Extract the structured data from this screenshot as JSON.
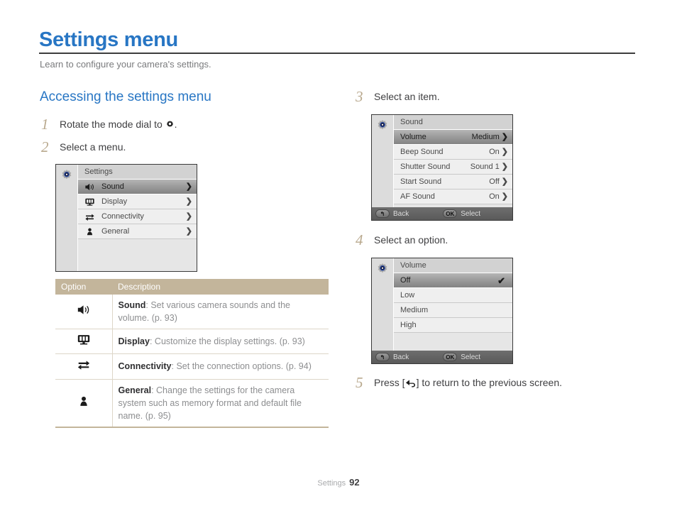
{
  "page": {
    "title": "Settings menu",
    "subtitle": "Learn to configure your camera's settings.",
    "section_heading": "Accessing the settings menu",
    "footer_label": "Settings",
    "footer_page": "92",
    "accent_color": "#2876c4",
    "step_number_color": "#b9a98e",
    "table_header_color": "#c3b59b"
  },
  "steps": {
    "one": {
      "num": "1",
      "text_before": "Rotate the mode dial to",
      "icon": "gear-icon",
      "text_after": "."
    },
    "two": {
      "num": "2",
      "text": "Select a menu."
    },
    "three": {
      "num": "3",
      "text": "Select an item."
    },
    "four": {
      "num": "4",
      "text": "Select an option."
    },
    "five": {
      "num": "5",
      "text_before": "Press [",
      "icon": "back-arrow-icon",
      "text_after": "] to return to the previous screen."
    }
  },
  "screen_settings": {
    "title": "Settings",
    "rows": [
      {
        "icon": "speaker-icon",
        "label": "Sound",
        "value": "",
        "chevron": "❯",
        "selected": true
      },
      {
        "icon": "display-icon",
        "label": "Display",
        "value": "",
        "chevron": "❯",
        "selected": false
      },
      {
        "icon": "connectivity-icon",
        "label": "Connectivity",
        "value": "",
        "chevron": "❯",
        "selected": false
      },
      {
        "icon": "person-icon",
        "label": "General",
        "value": "",
        "chevron": "❯",
        "selected": false
      }
    ]
  },
  "screen_sound": {
    "title": "Sound",
    "rows": [
      {
        "label": "Volume",
        "value": "Medium",
        "chevron": "❯",
        "selected": true
      },
      {
        "label": "Beep Sound",
        "value": "On",
        "chevron": "❯",
        "selected": false
      },
      {
        "label": "Shutter Sound",
        "value": "Sound 1",
        "chevron": "❯",
        "selected": false
      },
      {
        "label": "Start Sound",
        "value": "Off",
        "chevron": "❯",
        "selected": false
      },
      {
        "label": "AF Sound",
        "value": "On",
        "chevron": "❯",
        "selected": false
      }
    ],
    "bottom": {
      "back_key": "↰",
      "back_label": "Back",
      "ok_key": "OK",
      "ok_label": "Select"
    }
  },
  "screen_volume": {
    "title": "Volume",
    "rows": [
      {
        "label": "Off",
        "checked": true,
        "selected": true
      },
      {
        "label": "Low",
        "checked": false,
        "selected": false
      },
      {
        "label": "Medium",
        "checked": false,
        "selected": false
      },
      {
        "label": "High",
        "checked": false,
        "selected": false
      }
    ],
    "check_glyph": "✔",
    "bottom": {
      "back_key": "↰",
      "back_label": "Back",
      "ok_key": "OK",
      "ok_label": "Select"
    }
  },
  "option_table": {
    "headers": [
      "Option",
      "Description"
    ],
    "rows": [
      {
        "icon": "speaker-icon",
        "name": "Sound",
        "desc": ": Set various camera sounds and the volume. (p. 93)"
      },
      {
        "icon": "display-icon",
        "name": "Display",
        "desc": ": Customize the display settings. (p. 93)"
      },
      {
        "icon": "connectivity-icon",
        "name": "Connectivity",
        "desc": ": Set the connection options. (p. 94)"
      },
      {
        "icon": "person-icon",
        "name": "General",
        "desc": ": Change the settings for the camera system such as memory format and default file name. (p. 95)"
      }
    ]
  }
}
